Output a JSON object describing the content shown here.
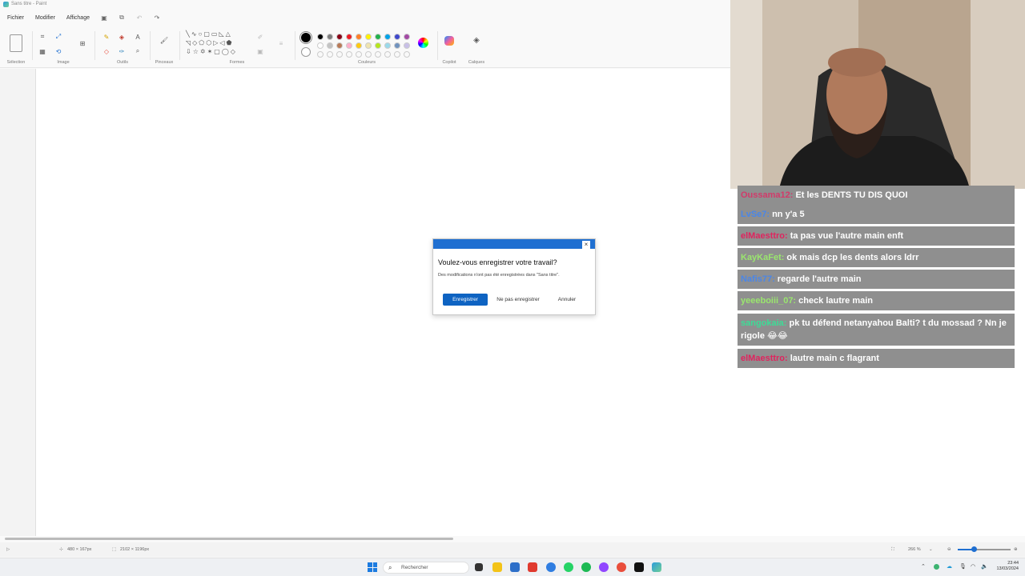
{
  "window": {
    "title": "Sans titre - Paint"
  },
  "menu": {
    "items": [
      "Fichier",
      "Modifier",
      "Affichage"
    ]
  },
  "ribbon": {
    "groups": [
      "Sélection",
      "Image",
      "Outils",
      "Pinceaux",
      "Formes",
      "Couleurs",
      "Copilot",
      "Calques"
    ],
    "text_tool_glyph": "A"
  },
  "palette": {
    "row1": [
      "#000000",
      "#7f7f7f",
      "#880015",
      "#ed1c24",
      "#ff7f27",
      "#fff200",
      "#22b14c",
      "#00a2e8",
      "#3f48cc",
      "#a349a4"
    ],
    "row2": [
      "#ffffff",
      "#c3c3c3",
      "#b97a57",
      "#ffaec9",
      "#ffc90e",
      "#efe4b0",
      "#b5e61d",
      "#99d9ea",
      "#7092be",
      "#c8bfe7"
    ]
  },
  "dialog": {
    "question": "Voulez-vous enregistrer votre travail?",
    "message": "Des modifications n'ont pas été enregistrées dans \"Sans titre\".",
    "save": "Enregistrer",
    "dont_save": "Ne pas enregistrer",
    "cancel": "Annuler",
    "close": "×"
  },
  "status": {
    "cursor": "480 × 167px",
    "canvas": "2102 × 1196px",
    "zoom": "266 %"
  },
  "taskbar": {
    "search_placeholder": "Rechercher",
    "time": "23:44",
    "date": "13/03/2024"
  },
  "chat": [
    {
      "user": "Oussama12",
      "text": "Et les DENTS TU DIS QUOI",
      "user_color": "#d23a6a"
    },
    {
      "user": "LvSe7",
      "text": "nn y'a 5",
      "user_color": "#4a86e8"
    },
    {
      "user": "elMaesttro",
      "text": "ta pas vue l'autre main enft",
      "user_color": "#e0245e"
    },
    {
      "user": "KayKaFet",
      "text": "ok mais dcp les dents alors ldrr",
      "user_color": "#9ae66e"
    },
    {
      "user": "Nafis77",
      "text": "regarde l'autre main",
      "user_color": "#4a86e8"
    },
    {
      "user": "yeeeboiii_07",
      "text": "check lautre main",
      "user_color": "#9ae66e"
    },
    {
      "user": "sangokaia",
      "text": "pk tu défend netanyahou Balti? t du mossad ? Nn je rigole 😂😂",
      "user_color": "#3ddc97"
    },
    {
      "user": "elMaesttro",
      "text": "lautre main c flagrant",
      "user_color": "#e0245e"
    }
  ]
}
